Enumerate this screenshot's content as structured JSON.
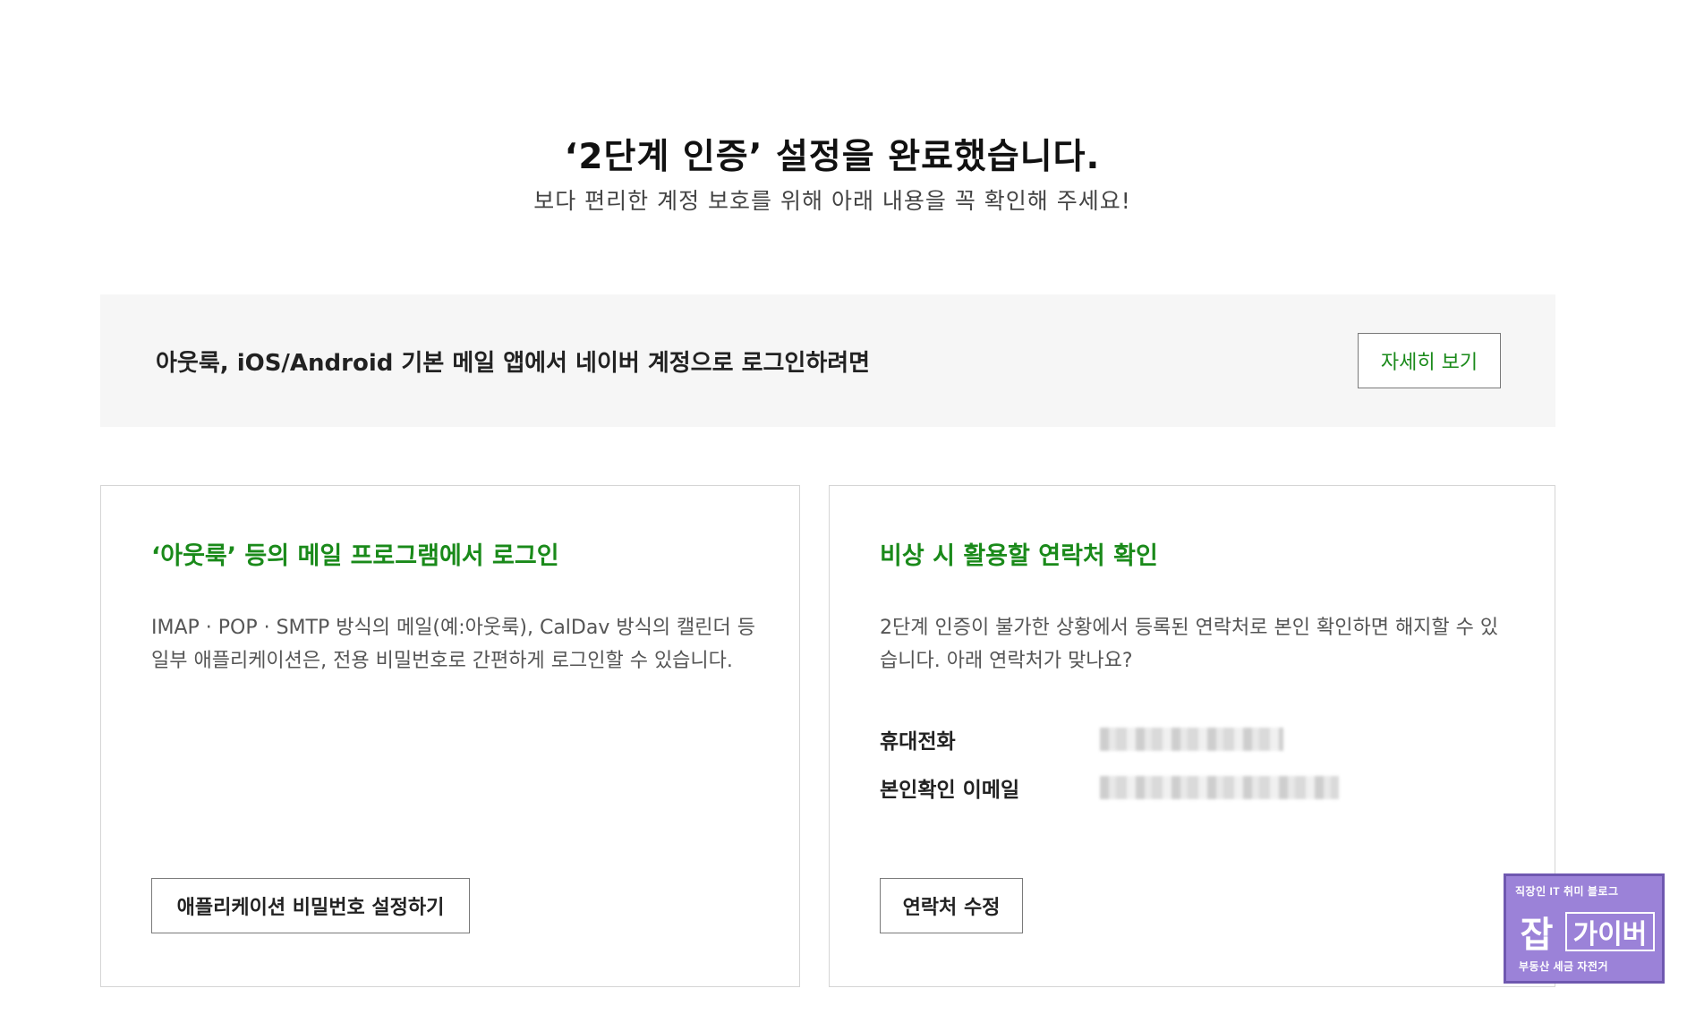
{
  "header": {
    "title": "‘2단계 인증’ 설정을 완료했습니다.",
    "subtitle": "보다 편리한 계정 보호를 위해 아래 내용을 꼭 확인해 주세요!"
  },
  "banner": {
    "text": "아웃룩, iOS/Android 기본 메일 앱에서 네이버 계정으로 로그인하려면",
    "button_label": "자세히 보기"
  },
  "mail_program_card": {
    "title": "‘아웃룩’ 등의 메일 프로그램에서 로그인",
    "description": "IMAP · POP · SMTP 방식의 메일(예:아웃룩), CalDav 방식의 캘린더 등 일부 애플리케이션은, 전용 비밀번호로 간편하게 로그인할 수 있습니다.",
    "button_label": "애플리케이션 비밀번호 설정하기"
  },
  "contact_card": {
    "title": "비상 시 활용할 연락처 확인",
    "description": "2단계 인증이 불가한 상황에서 등록된 연락처로 본인 확인하면 해지할 수 있습니다. 아래 연락처가 맞나요?",
    "contacts": [
      {
        "label": "휴대전화"
      },
      {
        "label": "본인확인 이메일"
      }
    ],
    "button_label": "연락처 수정"
  },
  "watermark": {
    "top_text": "직장인 IT 취미 블로그",
    "big_char": "잡",
    "box_text": "가이버",
    "bottom_text": "부동산 세금 자전거"
  },
  "colors": {
    "accent_green": "#1a8a1a",
    "banner_bg": "#f6f6f6",
    "badge_purple": "#9b82d8"
  }
}
